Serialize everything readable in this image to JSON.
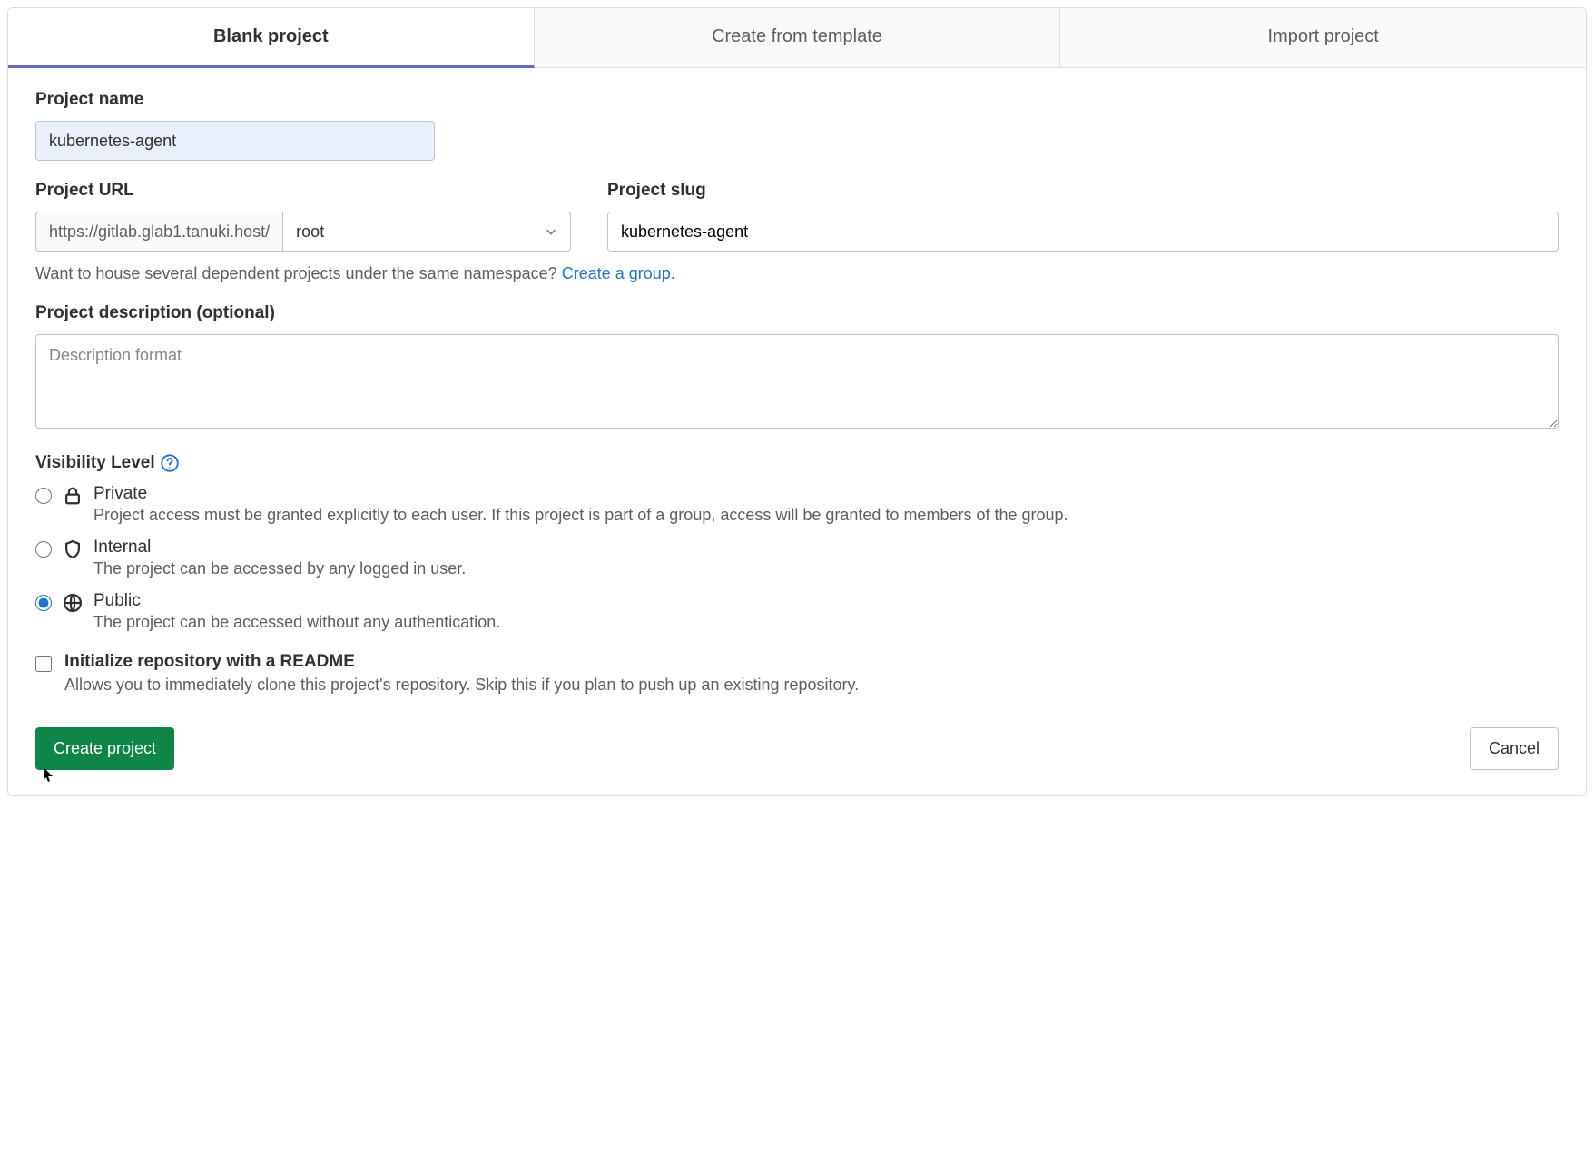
{
  "tabs": {
    "blank": "Blank project",
    "template": "Create from template",
    "import": "Import project"
  },
  "projectName": {
    "label": "Project name",
    "value": "kubernetes-agent"
  },
  "projectUrl": {
    "label": "Project URL",
    "prefix": "https://gitlab.glab1.tanuki.host/",
    "namespace": "root"
  },
  "projectSlug": {
    "label": "Project slug",
    "value": "kubernetes-agent"
  },
  "namespaceHint": {
    "text": "Want to house several dependent projects under the same namespace? ",
    "link": "Create a group."
  },
  "description": {
    "label": "Project description (optional)",
    "placeholder": "Description format"
  },
  "visibility": {
    "label": "Visibility Level",
    "private": {
      "title": "Private",
      "desc": "Project access must be granted explicitly to each user. If this project is part of a group, access will be granted to members of the group."
    },
    "internal": {
      "title": "Internal",
      "desc": "The project can be accessed by any logged in user."
    },
    "public": {
      "title": "Public",
      "desc": "The project can be accessed without any authentication."
    },
    "selected": "public"
  },
  "readme": {
    "title": "Initialize repository with a README",
    "desc": "Allows you to immediately clone this project's repository. Skip this if you plan to push up an existing repository.",
    "checked": false
  },
  "actions": {
    "create": "Create project",
    "cancel": "Cancel"
  }
}
